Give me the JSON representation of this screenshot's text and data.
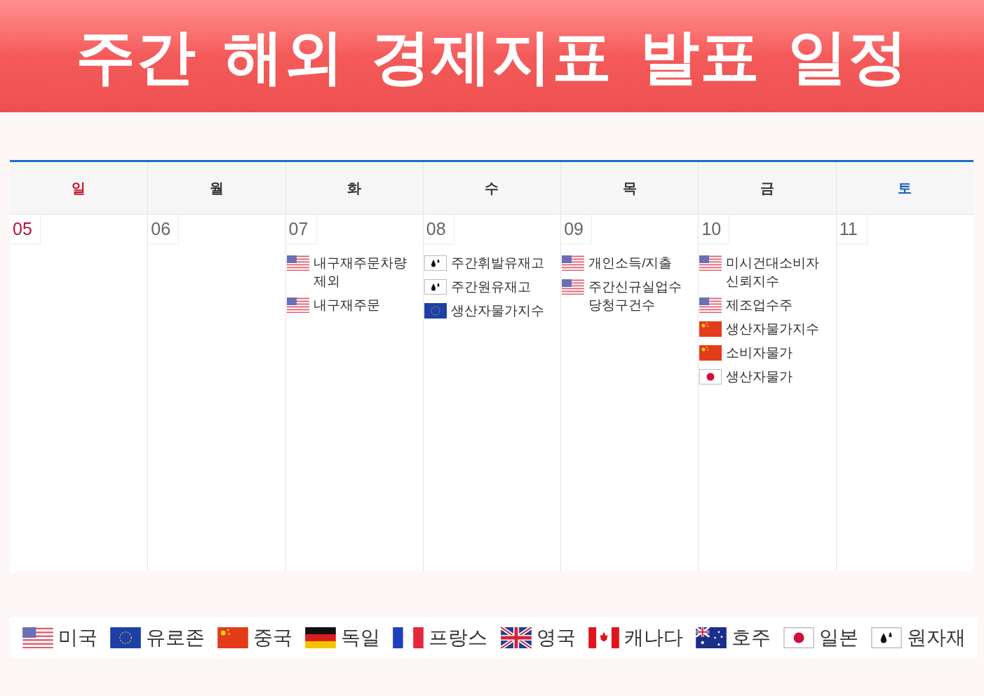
{
  "banner": {
    "title": "주간 해외 경제지표 발표 일정"
  },
  "calendar": {
    "days": [
      {
        "weekday": "일",
        "date": "05",
        "kind": "sunday"
      },
      {
        "weekday": "월",
        "date": "06",
        "kind": "weekday"
      },
      {
        "weekday": "화",
        "date": "07",
        "kind": "weekday",
        "events": [
          {
            "kind": "us",
            "lines": [
              "내구재주문차량",
              "제외"
            ]
          },
          {
            "kind": "us",
            "lines": [
              "내구재주문"
            ]
          }
        ]
      },
      {
        "weekday": "수",
        "date": "08",
        "kind": "weekday",
        "events": [
          {
            "kind": "oil",
            "lines": [
              "주간휘발유재고"
            ]
          },
          {
            "kind": "oil",
            "lines": [
              "주간원유재고"
            ]
          },
          {
            "kind": "eu",
            "lines": [
              "생산자물가지수"
            ]
          }
        ]
      },
      {
        "weekday": "목",
        "date": "09",
        "kind": "weekday",
        "events": [
          {
            "kind": "us",
            "lines": [
              "개인소득/지출"
            ]
          },
          {
            "kind": "us",
            "lines": [
              "주간신규실업수",
              "당청구건수"
            ]
          }
        ]
      },
      {
        "weekday": "금",
        "date": "10",
        "kind": "weekday",
        "events": [
          {
            "kind": "us",
            "lines": [
              "미시건대소비자",
              "신뢰지수"
            ]
          },
          {
            "kind": "us",
            "lines": [
              "제조업수주"
            ]
          },
          {
            "kind": "cn",
            "lines": [
              "생산자물가지수"
            ]
          },
          {
            "kind": "cn",
            "lines": [
              "소비자물가"
            ]
          },
          {
            "kind": "jp",
            "lines": [
              "생산자물가"
            ]
          }
        ]
      },
      {
        "weekday": "토",
        "date": "11",
        "kind": "saturday"
      }
    ]
  },
  "legend": [
    {
      "kind": "us",
      "label": "미국"
    },
    {
      "kind": "eu",
      "label": "유로존"
    },
    {
      "kind": "cn",
      "label": "중국"
    },
    {
      "kind": "de",
      "label": "독일"
    },
    {
      "kind": "fr",
      "label": "프랑스"
    },
    {
      "kind": "gb",
      "label": "영국"
    },
    {
      "kind": "ca",
      "label": "캐나다"
    },
    {
      "kind": "au",
      "label": "호주"
    },
    {
      "kind": "jp",
      "label": "일본"
    },
    {
      "kind": "oil",
      "label": "원자재"
    }
  ]
}
